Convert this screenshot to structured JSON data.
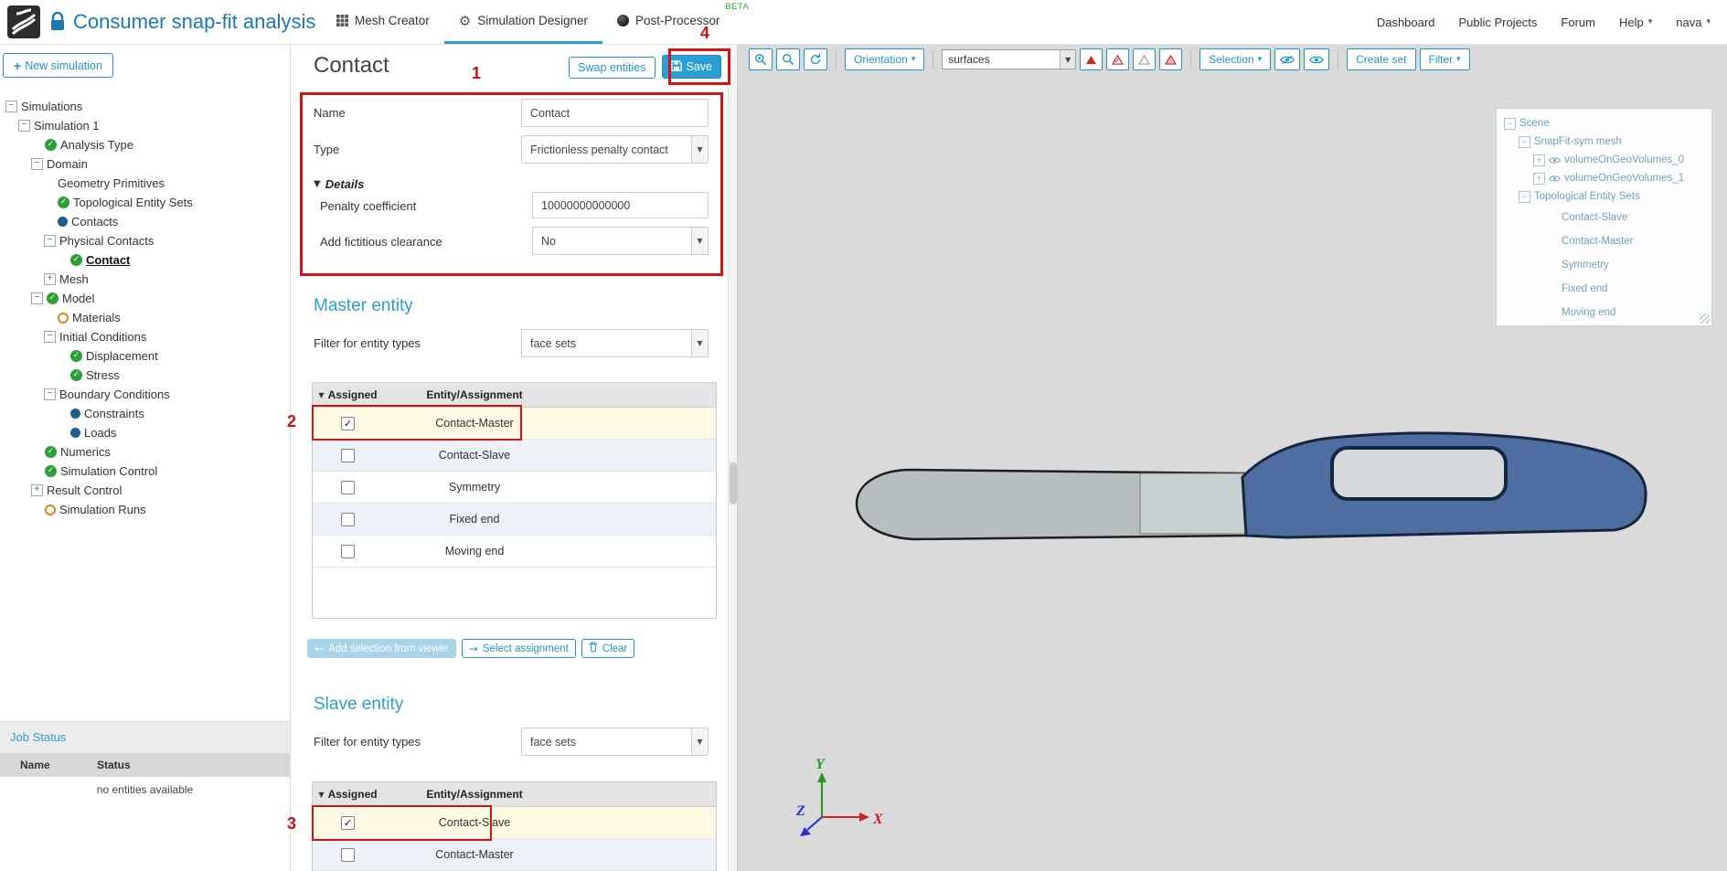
{
  "header": {
    "title": "Consumer snap-fit analysis",
    "tabs": [
      {
        "label": "Mesh Creator"
      },
      {
        "label": "Simulation Designer"
      },
      {
        "label": "Post-Processor",
        "badge": "BETA"
      }
    ],
    "links": {
      "dashboard": "Dashboard",
      "public_projects": "Public Projects",
      "forum": "Forum",
      "help": "Help",
      "user": "nava"
    }
  },
  "icons": {
    "plus": "+",
    "caret_down": "▾",
    "sort_desc": "▼",
    "details_triangle": "▼",
    "check": "✓",
    "collapse": "−",
    "expand": "+",
    "select_arrow": "▼",
    "back_arrow": "←",
    "forward_arrow": "→"
  },
  "sidebar": {
    "new_simulation": "New simulation",
    "tree": [
      {
        "label": "Simulations",
        "level": 0,
        "expander": "minus",
        "icon": "none"
      },
      {
        "label": "Simulation 1",
        "level": 1,
        "expander": "minus",
        "icon": "none"
      },
      {
        "label": "Analysis Type",
        "level": 2,
        "expander": "none",
        "icon": "check"
      },
      {
        "label": "Domain",
        "level": 2,
        "expander": "minus",
        "icon": "none"
      },
      {
        "label": "Geometry Primitives",
        "level": 3,
        "expander": "none",
        "icon": "none"
      },
      {
        "label": "Topological Entity Sets",
        "level": 3,
        "expander": "none",
        "icon": "check"
      },
      {
        "label": "Contacts",
        "level": 3,
        "expander": "none",
        "icon": "dot"
      },
      {
        "label": "Physical Contacts",
        "level": 3,
        "expander": "minus",
        "icon": "none"
      },
      {
        "label": "Contact",
        "level": 4,
        "expander": "none",
        "icon": "check",
        "selected": true
      },
      {
        "label": "Mesh",
        "level": 3,
        "expander": "plus",
        "icon": "none"
      },
      {
        "label": "Model",
        "level": 2,
        "expander": "minus",
        "icon": "check"
      },
      {
        "label": "Materials",
        "level": 3,
        "expander": "none",
        "icon": "warn"
      },
      {
        "label": "Initial Conditions",
        "level": 3,
        "expander": "minus",
        "icon": "none"
      },
      {
        "label": "Displacement",
        "level": 4,
        "expander": "none",
        "icon": "check"
      },
      {
        "label": "Stress",
        "level": 4,
        "expander": "none",
        "icon": "check"
      },
      {
        "label": "Boundary Conditions",
        "level": 3,
        "expander": "minus",
        "icon": "none"
      },
      {
        "label": "Constraints",
        "level": 4,
        "expander": "none",
        "icon": "dot"
      },
      {
        "label": "Loads",
        "level": 4,
        "expander": "none",
        "icon": "dot"
      },
      {
        "label": "Numerics",
        "level": 2,
        "expander": "none",
        "icon": "check"
      },
      {
        "label": "Simulation Control",
        "level": 2,
        "expander": "none",
        "icon": "check"
      },
      {
        "label": "Result Control",
        "level": 2,
        "expander": "plus",
        "icon": "none"
      },
      {
        "label": "Simulation Runs",
        "level": 2,
        "expander": "none",
        "icon": "warn"
      }
    ],
    "job_status": {
      "title": "Job Status",
      "name_col": "Name",
      "status_col": "Status",
      "empty": "no entities available"
    }
  },
  "panel": {
    "title": "Contact",
    "swap_button": "Swap entities",
    "save_button": "Save",
    "form": {
      "name_label": "Name",
      "name_value": "Contact",
      "type_label": "Type",
      "type_value": "Frictionless penalty contact",
      "details_label": "Details",
      "penalty_label": "Penalty coefficient",
      "penalty_value": "10000000000000",
      "clearance_label": "Add fictitious clearance",
      "clearance_value": "No"
    },
    "master": {
      "heading": "Master entity",
      "filter_label": "Filter for entity types",
      "filter_value": "face sets",
      "assigned_header": "Assigned",
      "entity_header": "Entity/Assignment",
      "rows": [
        {
          "label": "Contact-Master",
          "checked": true
        },
        {
          "label": "Contact-Slave",
          "checked": false
        },
        {
          "label": "Symmetry",
          "checked": false
        },
        {
          "label": "Fixed end",
          "checked": false
        },
        {
          "label": "Moving end",
          "checked": false
        }
      ],
      "add_button": "Add selection from viewer",
      "select_button": "Select assignment",
      "clear_button": "Clear"
    },
    "slave": {
      "heading": "Slave entity",
      "filter_label": "Filter for entity types",
      "filter_value": "face sets",
      "assigned_header": "Assigned",
      "entity_header": "Entity/Assignment",
      "rows": [
        {
          "label": "Contact-Slave",
          "checked": true
        },
        {
          "label": "Contact-Master",
          "checked": false
        }
      ]
    }
  },
  "viewer": {
    "toolbar": {
      "orientation": "Orientation",
      "surfaces": "surfaces",
      "selection": "Selection",
      "create_set": "Create set",
      "filter": "Filter"
    },
    "scene_tree": [
      {
        "label": "Scene",
        "level": 0,
        "expander": "minus",
        "eye": false,
        "wide": false
      },
      {
        "label": "SnapFit-sym mesh",
        "level": 1,
        "expander": "minus",
        "eye": false,
        "wide": false
      },
      {
        "label": "volumeOnGeoVolumes_0",
        "level": 2,
        "expander": "plus",
        "eye": true,
        "wide": false
      },
      {
        "label": "volumeOnGeoVolumes_1",
        "level": 2,
        "expander": "plus",
        "eye": true,
        "wide": false
      },
      {
        "label": "Topological Entity Sets",
        "level": 1,
        "expander": "minus",
        "eye": false,
        "wide": false
      },
      {
        "label": "Contact-Slave",
        "level": 3,
        "expander": "none",
        "eye": false,
        "wide": true
      },
      {
        "label": "Contact-Master",
        "level": 3,
        "expander": "none",
        "eye": false,
        "wide": true
      },
      {
        "label": "Symmetry",
        "level": 3,
        "expander": "none",
        "eye": false,
        "wide": true
      },
      {
        "label": "Fixed end",
        "level": 3,
        "expander": "none",
        "eye": false,
        "wide": true
      },
      {
        "label": "Moving end",
        "level": 3,
        "expander": "none",
        "eye": false,
        "wide": true
      }
    ],
    "axes": {
      "x": "X",
      "y": "Y",
      "z": "Z"
    }
  },
  "annotations": {
    "n1": "1",
    "n2": "2",
    "n3": "3",
    "n4": "4"
  }
}
